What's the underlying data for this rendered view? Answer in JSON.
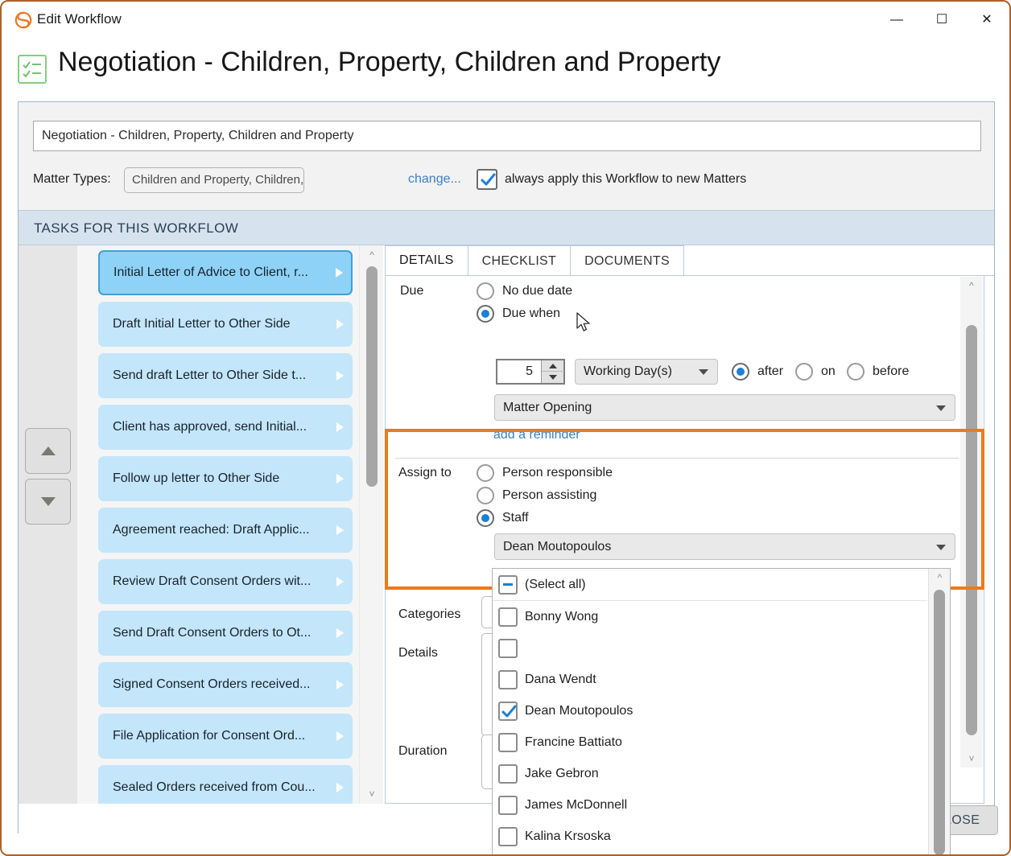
{
  "window": {
    "title": "Edit Workflow",
    "app_icon": "leap-s-icon",
    "controls": {
      "minimize": "—",
      "maximize": "❑",
      "close": "✕"
    }
  },
  "header": {
    "icon": "checklist-icon",
    "title": "Negotiation - Children, Property, Children and Property"
  },
  "form": {
    "workflow_name": "Negotiation - Children, Property, Children and Property",
    "matter_types_label": "Matter Types:",
    "matter_types_value": "Children and Property, Children, Property",
    "change_link": "change...",
    "always_apply_label": "always apply this Workflow to new Matters",
    "always_apply_checked": true
  },
  "section": {
    "title": "TASKS FOR THIS WORKFLOW"
  },
  "rail": {
    "move_up": "move-up",
    "move_down": "move-down"
  },
  "tasks": [
    {
      "label": "Initial Letter of Advice to Client, r...",
      "selected": true
    },
    {
      "label": "Draft Initial Letter to Other Side",
      "selected": false
    },
    {
      "label": "Send draft Letter to Other Side t...",
      "selected": false
    },
    {
      "label": "Client has approved, send Initial...",
      "selected": false
    },
    {
      "label": "Follow up letter to Other Side",
      "selected": false
    },
    {
      "label": "Agreement reached: Draft Applic...",
      "selected": false
    },
    {
      "label": "Review Draft Consent Orders wit...",
      "selected": false
    },
    {
      "label": "Send Draft Consent Orders to Ot...",
      "selected": false
    },
    {
      "label": "Signed Consent Orders received...",
      "selected": false
    },
    {
      "label": "File Application for Consent Ord...",
      "selected": false
    },
    {
      "label": "Sealed Orders received from Cou...",
      "selected": false
    }
  ],
  "detail": {
    "tabs": [
      {
        "label": "DETAILS",
        "active": true
      },
      {
        "label": "CHECKLIST",
        "active": false
      },
      {
        "label": "DOCUMENTS",
        "active": false
      }
    ],
    "due": {
      "label": "Due",
      "no_due_date": "No due date",
      "due_when": "Due when",
      "selected": "Due when",
      "amount": "5",
      "unit": "Working Day(s)",
      "offset_options": [
        "after",
        "on",
        "before"
      ],
      "offset_selected": "after",
      "event": "Matter Opening",
      "add_reminder": "add a reminder"
    },
    "assign": {
      "label": "Assign to",
      "options": [
        "Person responsible",
        "Person assisting",
        "Staff"
      ],
      "selected": "Staff",
      "staff_value": "Dean Moutopoulos"
    },
    "categories_label": "Categories",
    "details_label": "Details",
    "duration_label": "Duration"
  },
  "dropdown": {
    "items": [
      {
        "label": "(Select all)",
        "state": "partial"
      },
      {
        "label": "Bonny Wong",
        "state": "unchecked"
      },
      {
        "label": "",
        "state": "unchecked"
      },
      {
        "label": "Dana Wendt",
        "state": "unchecked"
      },
      {
        "label": "Dean Moutopoulos",
        "state": "checked"
      },
      {
        "label": "Francine Battiato",
        "state": "unchecked"
      },
      {
        "label": "Jake Gebron",
        "state": "unchecked"
      },
      {
        "label": "James McDonnell",
        "state": "unchecked"
      },
      {
        "label": "Kalina Krsoska",
        "state": "unchecked"
      }
    ]
  },
  "footer": {
    "close_label": "LOSE"
  },
  "colors": {
    "accent_orange": "#ec7a1c",
    "link_blue": "#3a7fc4",
    "radio_blue": "#1d7fd4",
    "task_blue": "#c3e6fb",
    "task_selected_blue": "#8ed3f7",
    "section_bar": "#d6e3ef",
    "window_border": "#b25f28"
  }
}
